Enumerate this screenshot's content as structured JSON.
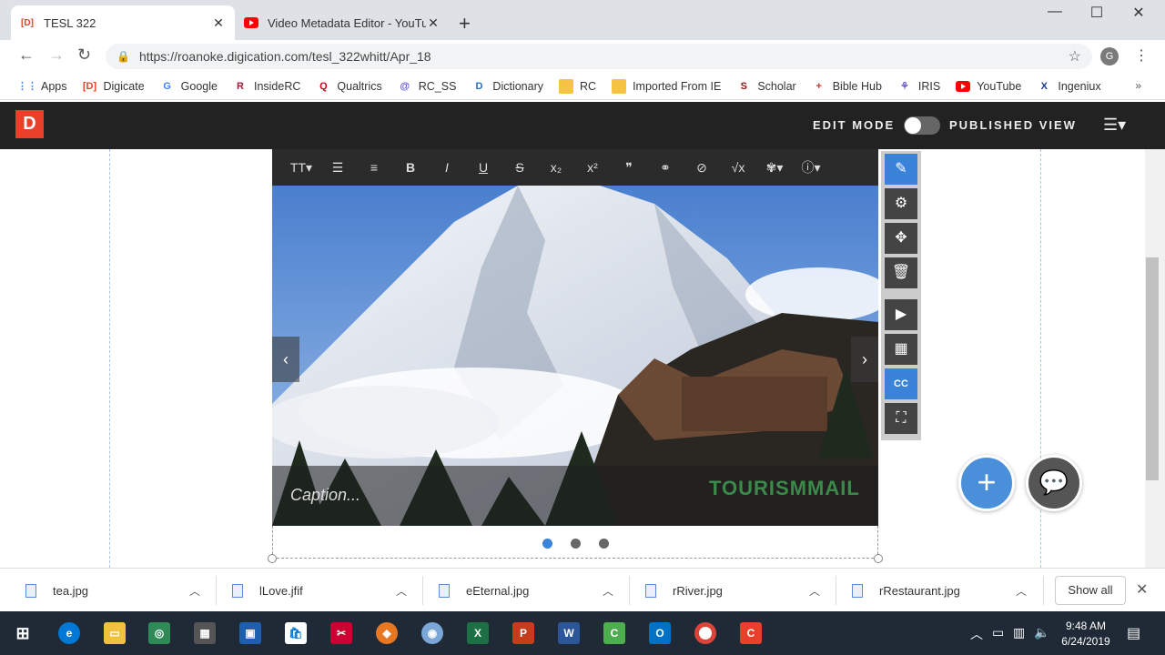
{
  "browser": {
    "tabs": [
      {
        "title": "TESL 322",
        "favicon": "[D]",
        "active": true
      },
      {
        "title": "Video Metadata Editor - YouTube",
        "favicon": "youtube-icon",
        "active": false
      }
    ],
    "new_tab": "+",
    "url": "https://roanoke.digication.com/tesl_322whitt/Apr_18",
    "profile_initial": "G"
  },
  "bookmarks": [
    {
      "label": "Apps",
      "icon": "apps-grid-icon",
      "color": "#4285f4"
    },
    {
      "label": "Digicate",
      "icon": "[D]",
      "color": "#e8402a"
    },
    {
      "label": "Google",
      "icon": "G",
      "color": "#4285f4"
    },
    {
      "label": "InsideRC",
      "icon": "R",
      "color": "#a31f34"
    },
    {
      "label": "Qualtrics",
      "icon": "Q",
      "color": "#d0021b"
    },
    {
      "label": "RC_SS",
      "icon": "@",
      "color": "#5a4fcf"
    },
    {
      "label": "Dictionary",
      "icon": "D",
      "color": "#2a6ebb"
    },
    {
      "label": "RC",
      "icon": "folder-icon",
      "color": "#f6c343"
    },
    {
      "label": "Imported From IE",
      "icon": "folder-icon",
      "color": "#f6c343"
    },
    {
      "label": "Scholar",
      "icon": "S",
      "color": "#8c1515"
    },
    {
      "label": "Bible Hub",
      "icon": "+",
      "color": "#c0392b"
    },
    {
      "label": "IRIS",
      "icon": "iris-icon",
      "color": "#6a5acd"
    },
    {
      "label": "YouTube",
      "icon": "youtube-icon",
      "color": "#ff0000"
    },
    {
      "label": "Ingeniux",
      "icon": "X",
      "color": "#1b3f8b"
    }
  ],
  "bookmarks_more": "»",
  "app": {
    "logo": "D",
    "edit_mode": "EDIT MODE",
    "published_view": "PUBLISHED VIEW",
    "accent": "#e8402a"
  },
  "editor_toolbar": [
    {
      "name": "font-size",
      "glyph": "TT▾"
    },
    {
      "name": "bulleted-list",
      "glyph": "☰"
    },
    {
      "name": "numbered-list",
      "glyph": "≡"
    },
    {
      "name": "bold",
      "glyph": "B"
    },
    {
      "name": "italic",
      "glyph": "I"
    },
    {
      "name": "underline",
      "glyph": "U"
    },
    {
      "name": "strikethrough",
      "glyph": "S"
    },
    {
      "name": "subscript",
      "glyph": "x₂"
    },
    {
      "name": "superscript",
      "glyph": "x²"
    },
    {
      "name": "blockquote",
      "glyph": "❞"
    },
    {
      "name": "link",
      "glyph": "⚭"
    },
    {
      "name": "attachment",
      "glyph": "⊘"
    },
    {
      "name": "equation",
      "glyph": "√x"
    },
    {
      "name": "accessibility",
      "glyph": "✾▾"
    },
    {
      "name": "info",
      "glyph": "ⓘ▾"
    }
  ],
  "slideshow": {
    "caption": "Caption...",
    "watermark": "TOURISMMAIL",
    "prev_arrow": "‹",
    "next_arrow": "›",
    "dots": 3,
    "active_dot": 1
  },
  "side_controls": [
    {
      "name": "edit",
      "glyph": "✎",
      "highlight": true
    },
    {
      "name": "settings",
      "glyph": "⚙",
      "highlight": false
    },
    {
      "name": "move",
      "glyph": "✥",
      "highlight": false
    },
    {
      "name": "delete",
      "glyph": "🗑",
      "highlight": false
    },
    {
      "name": "play",
      "glyph": "▶",
      "highlight": false
    },
    {
      "name": "grid",
      "glyph": "▦",
      "highlight": false
    },
    {
      "name": "closed-captions",
      "glyph": "CC",
      "highlight": true
    },
    {
      "name": "fullscreen",
      "glyph": "⛶",
      "highlight": false
    }
  ],
  "fabs": {
    "add": "+",
    "comments": "💬"
  },
  "downloads": [
    {
      "name": "tea.jpg"
    },
    {
      "name": "lLove.jfif"
    },
    {
      "name": "eEternal.jpg"
    },
    {
      "name": "rRiver.jpg"
    },
    {
      "name": "rRestaurant.jpg"
    }
  ],
  "show_all": "Show all",
  "taskbar": {
    "time": "9:48 AM",
    "date": "6/24/2019"
  }
}
